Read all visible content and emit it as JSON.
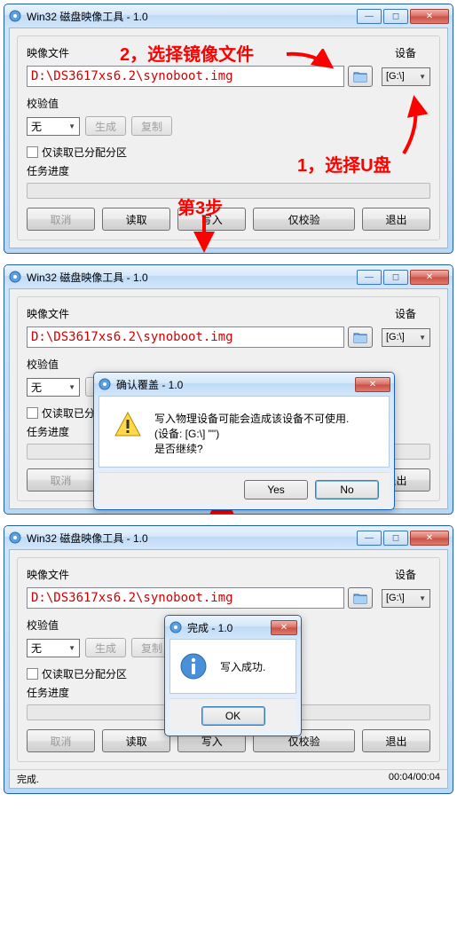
{
  "app": {
    "title": "Win32 磁盘映像工具 - 1.0",
    "icon_name": "disk-image-icon"
  },
  "labels": {
    "image_file": "映像文件",
    "device": "设备",
    "checksum": "校验值",
    "generate": "生成",
    "copy": "复制",
    "read_only_allocated": "仅读取已分配分区",
    "task_progress": "任务进度"
  },
  "data": {
    "filepath": "D:\\DS3617xs6.2\\synoboot.img",
    "device_selected": "[G:\\]",
    "checksum_type": "无"
  },
  "buttons": {
    "cancel": "取消",
    "read": "读取",
    "write": "写入",
    "verify_only": "仅校验",
    "exit": "退出"
  },
  "annotations": {
    "a1": "1，选择U盘",
    "a2": "2，选择镜像文件",
    "a3": "第3步"
  },
  "dialog_confirm": {
    "title": "确认覆盖 - 1.0",
    "line1": "写入物理设备可能会造成该设备不可使用.",
    "line2": "(设备: [G:\\] \"\")",
    "line3": "是否继续?",
    "yes": "Yes",
    "no": "No"
  },
  "dialog_done": {
    "title": "完成 - 1.0",
    "message": "写入成功.",
    "ok": "OK"
  },
  "status": {
    "text": "完成.",
    "time": "00:04/00:04"
  }
}
